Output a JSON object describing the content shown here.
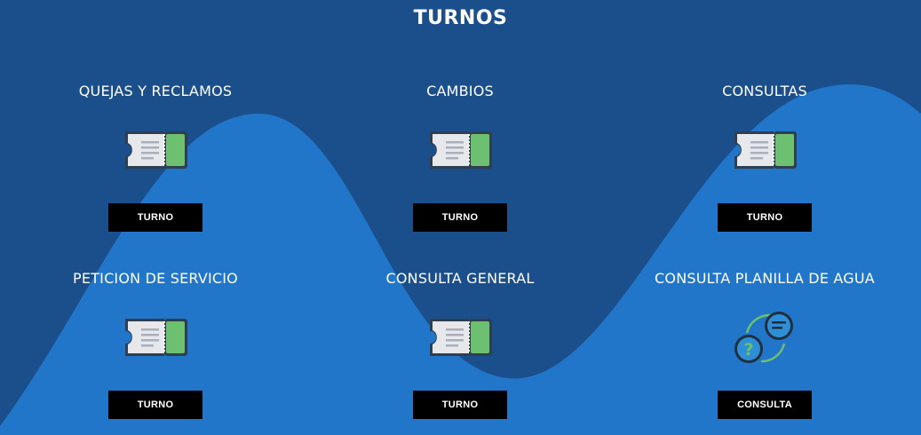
{
  "page": {
    "title": "TURNOS"
  },
  "colors": {
    "background": "#1b4f8b",
    "wave": "#2176c9",
    "button": "#000000",
    "ticket_green": "#6cc070"
  },
  "cards": [
    {
      "title": "QUEJAS Y RECLAMOS",
      "icon": "ticket-icon",
      "button_label": "TURNO"
    },
    {
      "title": "CAMBIOS",
      "icon": "ticket-icon",
      "button_label": "TURNO"
    },
    {
      "title": "CONSULTAS",
      "icon": "ticket-icon",
      "button_label": "TURNO"
    },
    {
      "title": "PETICION DE SERVICIO",
      "icon": "ticket-icon",
      "button_label": "TURNO"
    },
    {
      "title": "CONSULTA GENERAL",
      "icon": "ticket-icon",
      "button_label": "TURNO"
    },
    {
      "title": "CONSULTA PLANILLA DE AGUA",
      "icon": "chat-question-icon",
      "button_label": "CONSULTA"
    }
  ]
}
